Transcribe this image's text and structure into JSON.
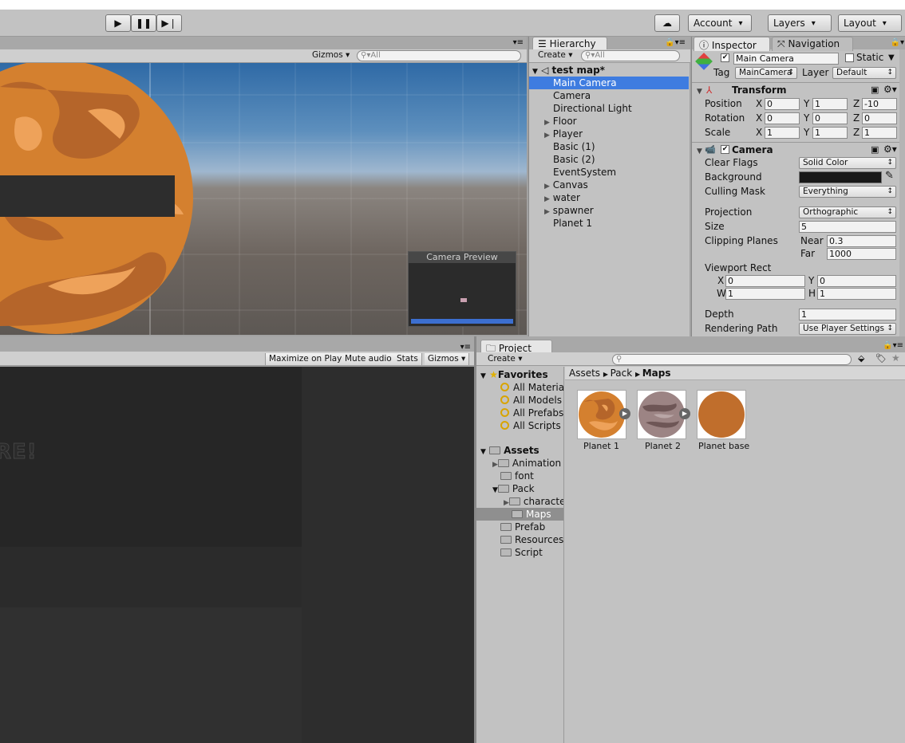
{
  "toolbar": {
    "account_label": "Account",
    "layers_label": "Layers",
    "layout_label": "Layout"
  },
  "scene": {
    "gizmos_label": "Gizmos",
    "search_placeholder": "All",
    "camera_preview_title": "Camera Preview"
  },
  "game": {
    "maximize_label": "Maximize on Play",
    "mute_label": "Mute audio",
    "stats_label": "Stats",
    "gizmos_label": "Gizmos",
    "overlay_text": "RE!"
  },
  "hierarchy": {
    "tab_label": "Hierarchy",
    "create_label": "Create",
    "search_placeholder": "All",
    "scene_name": "test map*",
    "items": [
      "Main Camera",
      "Camera",
      "Directional Light",
      "Floor",
      "Player",
      "Basic (1)",
      "Basic (2)",
      "EventSystem",
      "Canvas",
      "water",
      "spawner",
      "Planet 1"
    ]
  },
  "inspector": {
    "tab_label": "Inspector",
    "nav_tab_label": "Navigation",
    "object_name": "Main Camera",
    "static_label": "Static",
    "tag_label": "Tag",
    "tag_value": "MainCamera",
    "layer_label": "Layer",
    "layer_value": "Default",
    "transform": {
      "title": "Transform",
      "position_label": "Position",
      "rotation_label": "Rotation",
      "scale_label": "Scale",
      "position": [
        "0",
        "1",
        "-10"
      ],
      "rotation": [
        "0",
        "0",
        "0"
      ],
      "scale": [
        "1",
        "1",
        "1"
      ],
      "axis": [
        "X",
        "Y",
        "Z"
      ]
    },
    "camera": {
      "title": "Camera",
      "clear_flags_label": "Clear Flags",
      "clear_flags": "Solid Color",
      "background_label": "Background",
      "culling_mask_label": "Culling Mask",
      "culling_mask": "Everything",
      "projection_label": "Projection",
      "projection": "Orthographic",
      "size_label": "Size",
      "size": "5",
      "clipping_label": "Clipping Planes",
      "near_label": "Near",
      "near": "0.3",
      "far_label": "Far",
      "far": "1000",
      "viewport_label": "Viewport Rect",
      "vx": "0",
      "vy": "0",
      "vw": "1",
      "vh": "1",
      "x_l": "X",
      "y_l": "Y",
      "w_l": "W",
      "h_l": "H",
      "depth_label": "Depth",
      "depth": "1",
      "rendering_path_label": "Rendering Path",
      "rendering_path": "Use Player Settings"
    }
  },
  "project": {
    "tab_label": "Project",
    "create_label": "Create",
    "favorites_label": "Favorites",
    "favorites": [
      "All Materia",
      "All Models",
      "All Prefabs",
      "All Scripts"
    ],
    "assets_label": "Assets",
    "tree": [
      "Animation",
      "font",
      "Pack",
      "characte",
      "Maps",
      "Prefab",
      "Resources",
      "Script"
    ],
    "breadcrumb": [
      "Assets",
      "Pack",
      "Maps"
    ],
    "assets": [
      "Planet 1",
      "Planet 2",
      "Planet base"
    ]
  },
  "colors": {
    "selection": "#3e7ce0",
    "sky_top": "#4a7fb3",
    "planet": "#d4802f",
    "planet_base": "#c06e2c",
    "game_bg": "#2b2b2b"
  }
}
